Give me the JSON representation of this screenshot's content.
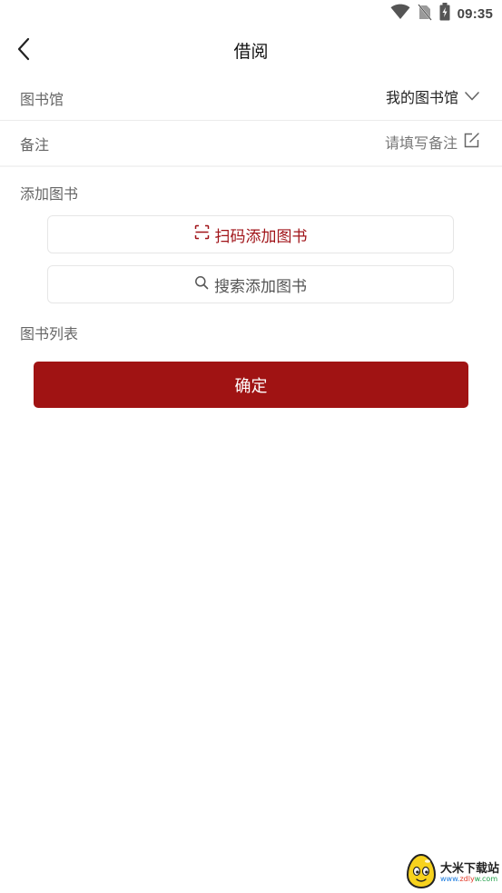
{
  "status_bar": {
    "time": "09:35",
    "icons": [
      "wifi-icon",
      "no-sim-icon",
      "battery-charging-icon"
    ]
  },
  "nav": {
    "title": "借阅",
    "back_icon": "chevron-left-icon"
  },
  "library_row": {
    "label": "图书馆",
    "value": "我的图书馆",
    "icon": "chevron-down-icon"
  },
  "remark_row": {
    "label": "备注",
    "placeholder": "请填写备注",
    "icon": "edit-icon"
  },
  "add_books": {
    "label": "添加图书",
    "scan_button": "扫码添加图书",
    "scan_icon": "scan-icon",
    "search_button": "搜索添加图书",
    "search_icon": "search-icon"
  },
  "book_list": {
    "label": "图书列表"
  },
  "confirm_button": "确定",
  "watermark": {
    "cn": "大米下载站",
    "url_parts": [
      "www.",
      "zdly",
      "w.com"
    ]
  },
  "colors": {
    "accent": "#a01313",
    "text_muted": "#666666",
    "divider": "#ececec"
  }
}
